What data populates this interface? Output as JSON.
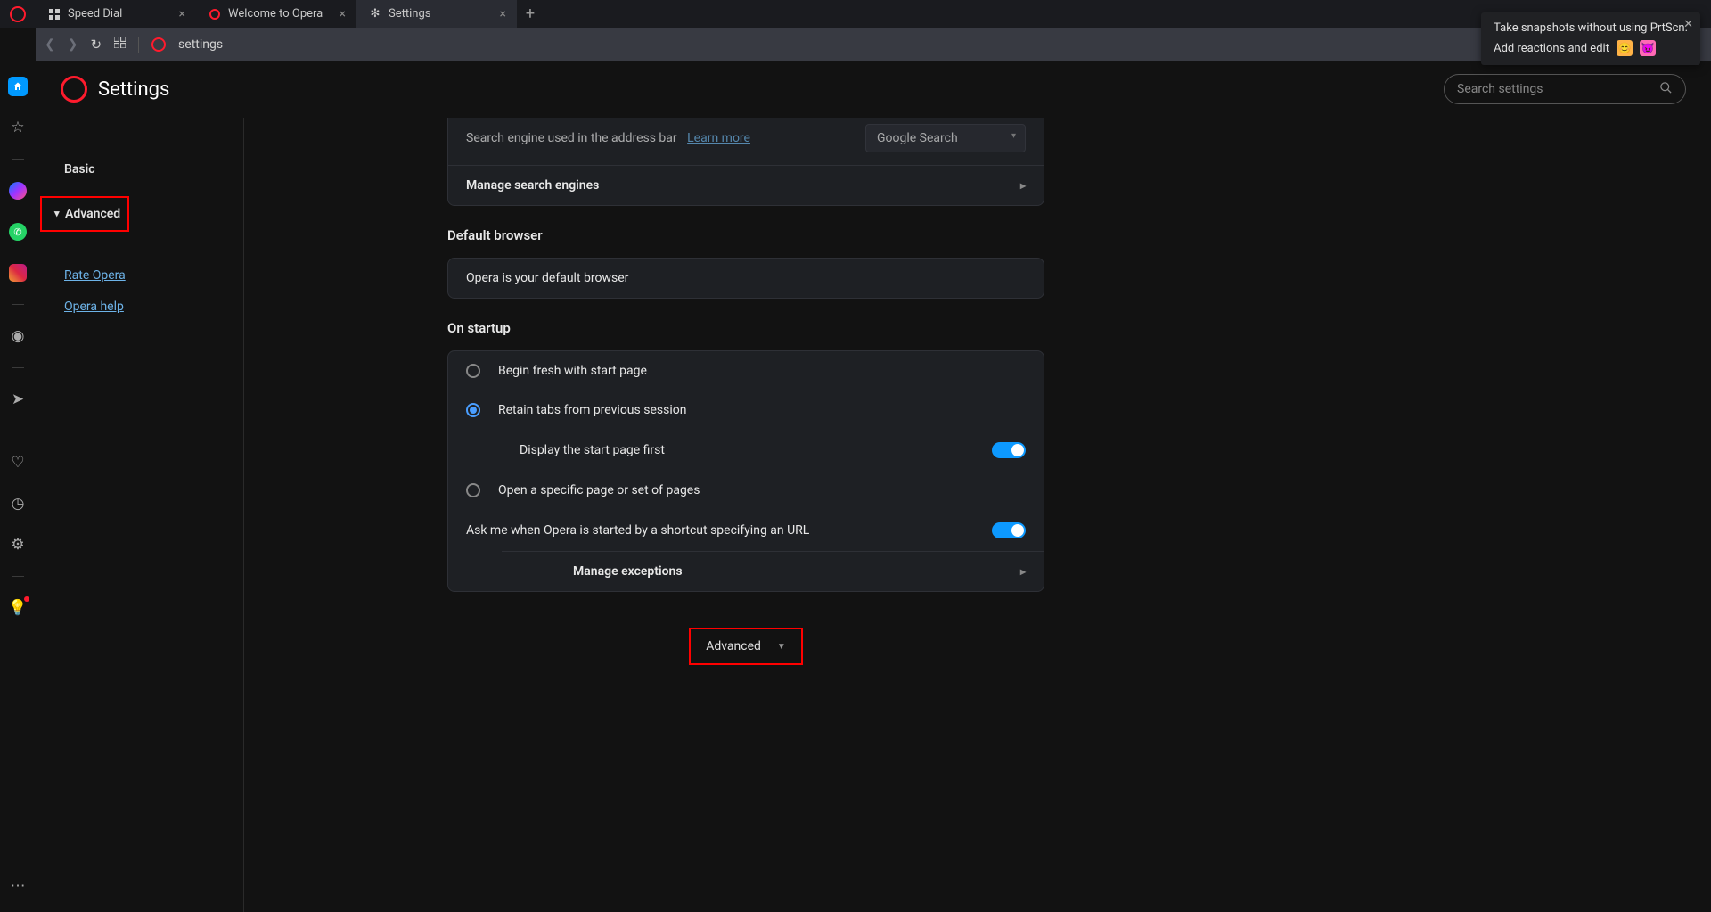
{
  "tabs": [
    {
      "title": "Speed Dial"
    },
    {
      "title": "Welcome to Opera"
    },
    {
      "title": "Settings"
    }
  ],
  "address": "settings",
  "header": {
    "title": "Settings",
    "search_placeholder": "Search settings"
  },
  "nav": {
    "basic": "Basic",
    "advanced": "Advanced",
    "rate": "Rate Opera",
    "help": "Opera help"
  },
  "search_engine": {
    "label": "Search engine used in the address bar",
    "learn_more": "Learn more",
    "value": "Google Search",
    "manage": "Manage search engines"
  },
  "default_browser": {
    "title": "Default browser",
    "status": "Opera is your default browser"
  },
  "startup": {
    "title": "On startup",
    "opt1": "Begin fresh with start page",
    "opt2": "Retain tabs from previous session",
    "opt2_sub": "Display the start page first",
    "opt3": "Open a specific page or set of pages",
    "ask": "Ask me when Opera is started by a shortcut specifying an URL",
    "manage_exc": "Manage exceptions"
  },
  "adv_button": "Advanced",
  "tooltip": {
    "line1": "Take snapshots without using PrtScn.",
    "line2": "Add reactions and edit"
  }
}
